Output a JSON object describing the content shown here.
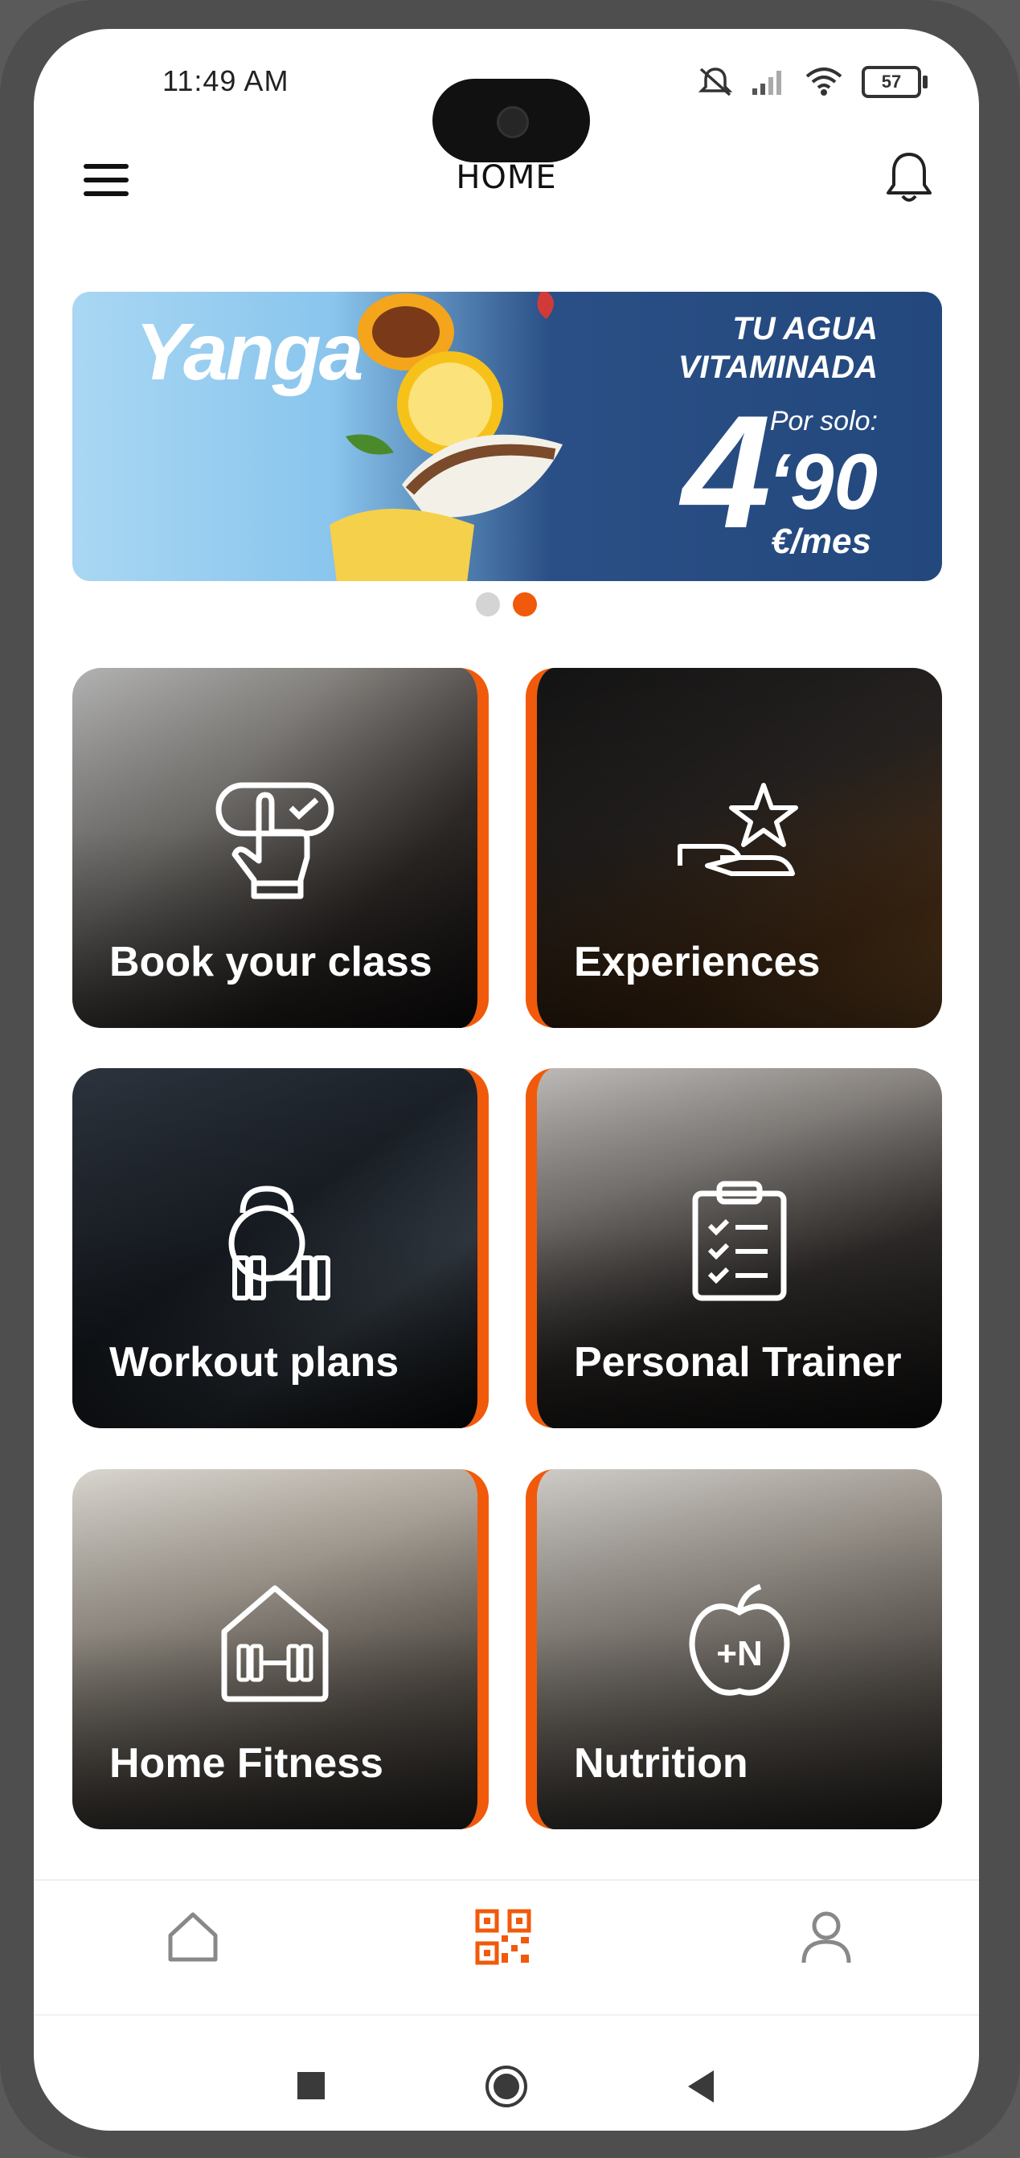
{
  "status_bar": {
    "time": "11:49 AM",
    "battery": "57",
    "icons": [
      "mute-icon",
      "signal-icon",
      "wifi-icon",
      "battery-icon"
    ]
  },
  "header": {
    "title": "HOME",
    "menu_icon": "hamburger-menu-icon",
    "notification_icon": "bell-icon"
  },
  "banner": {
    "brand": "Yanga",
    "tagline_line1": "TU AGUA",
    "tagline_line2": "VITAMINADA",
    "price_label": "Por solo:",
    "price_main": "4",
    "price_cents": "‘90",
    "price_unit": "€/mes",
    "slides": 2,
    "active_slide": 2
  },
  "tiles": [
    {
      "label": "Book your class",
      "icon": "hand-tap-icon"
    },
    {
      "label": "Experiences",
      "icon": "hand-star-icon"
    },
    {
      "label": "Workout plans",
      "icon": "kettlebell-dumbbell-icon"
    },
    {
      "label": "Personal Trainer",
      "icon": "clipboard-checklist-icon"
    },
    {
      "label": "Home Fitness",
      "icon": "house-dumbbell-icon"
    },
    {
      "label": "Nutrition",
      "icon": "apple-plus-n-icon"
    }
  ],
  "bottom_nav": {
    "items": [
      "home-icon",
      "qr-code-icon",
      "profile-icon"
    ],
    "active": "qr-code-icon"
  },
  "system_nav": [
    "recent-apps-icon",
    "home-circle-icon",
    "back-triangle-icon"
  ],
  "colors": {
    "accent": "#f05a0a",
    "banner_dark": "#23487d",
    "banner_light": "#a9d7f3"
  }
}
